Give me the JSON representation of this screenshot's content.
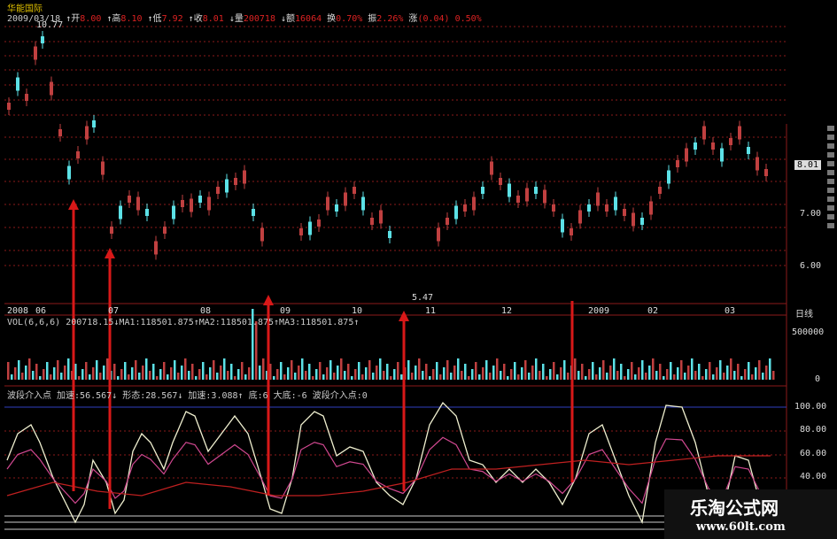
{
  "app": {
    "stock_name": "华能国际",
    "period_label": "日线"
  },
  "price_header": {
    "date": "2009/03/18",
    "fields": [
      {
        "label": "开",
        "value": "8.00",
        "arrow": "↑"
      },
      {
        "label": "高",
        "value": "8.10",
        "arrow": "↑"
      },
      {
        "label": "低",
        "value": "7.92",
        "arrow": "↑"
      },
      {
        "label": "收",
        "value": "8.01",
        "arrow": "↑"
      },
      {
        "label": "量",
        "value": "200718",
        "arrow": "↓"
      },
      {
        "label": "额",
        "value": "16064",
        "arrow": "↓"
      },
      {
        "label": "换",
        "value": "0.70%",
        "arrow": ""
      },
      {
        "label": "振",
        "value": "2.26%",
        "arrow": ""
      },
      {
        "label": "涨",
        "value": "(0.04)",
        "arrow": ""
      },
      {
        "label": "",
        "value": "0.50%",
        "arrow": ""
      }
    ]
  },
  "price_panel": {
    "high_label": "10.77",
    "low_label": "5.47",
    "current_price": "8.01",
    "y_ticks": [
      "7.00",
      "6.00"
    ]
  },
  "date_axis": [
    "2008",
    "06",
    "07",
    "08",
    "09",
    "10",
    "11",
    "12",
    "2009",
    "02",
    "03"
  ],
  "volume_panel": {
    "header": "VOL(6,6,6) 200718.15↓MA1:118501.875↑MA2:118501.875↑MA3:118501.875↑",
    "y_ticks": [
      "500000",
      "0"
    ]
  },
  "indicator_panel": {
    "name": "波段介入点",
    "fields": [
      {
        "label": "加速",
        "value": "56.567",
        "arrow": "↓"
      },
      {
        "label": "形态",
        "value": "28.567",
        "arrow": "↓"
      },
      {
        "label": "加速",
        "value": "3.088",
        "arrow": "↑"
      },
      {
        "label": "底",
        "value": "6",
        "arrow": ""
      },
      {
        "label": "大底",
        "value": "-6",
        "arrow": ""
      }
    ],
    "entry_label": "波段介入点:0",
    "y_ticks": [
      "100.00",
      "80.00",
      "60.00",
      "40.00"
    ]
  },
  "watermark": {
    "name": "乐淘公式网",
    "url": "www.60lt.com"
  },
  "colors": {
    "up": "#c04040",
    "down": "#5ce1e6",
    "grid": "#8b1a1a",
    "arrow": "#d81818",
    "white_line": "#f0f0d0",
    "magenta_line": "#d04890",
    "red_line": "#c02020"
  }
}
